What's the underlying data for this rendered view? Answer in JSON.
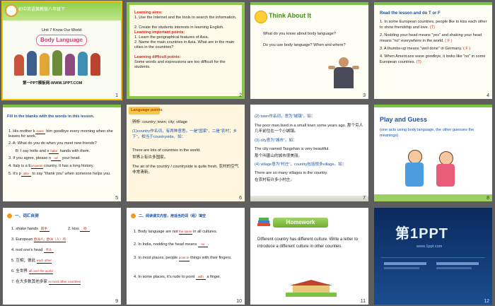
{
  "slides": [
    {
      "n": "1",
      "header": "初中英语冀教版八年级下",
      "unit": "Unit 7 Know Our World",
      "title": "Body Language",
      "footer": "第一PPT模板网-WWW.1PPT.COM"
    },
    {
      "n": "2",
      "l1": "Learning aims:",
      "l2": "1. Use the Internet and the tools to search the information.",
      "l3": "2. Create the students interests in learning English.",
      "l4": "Learning important points:",
      "l5": "1. Learn the geographical  features of Asia.",
      "l6": "2. Name the main countries in Asia. What are in the main cities in the countries?",
      "l7": "Learning difficult points:",
      "l8": "Some words and expressions are too difficult for the students."
    },
    {
      "n": "3",
      "title": "Think About It",
      "q1": "What do you know about body language?",
      "q2": "Do you use body language? When and where?"
    },
    {
      "n": "4",
      "title": "Read the lesson and do T or F",
      "s1": "1. In some European countries, people like to kiss each other to show friendship and love.",
      "a1": "(T)",
      "s2": "2. Nodding your head means  \"yes\" and shaking your head means \"no\" everywhere in the world.",
      "a2": "( F )",
      "s3": "3. A thumbs-up means \"well done\" in Germany.",
      "a3": "( F )",
      "s4": "4. When Americans wave goodbye, it looks like \"no\" in some European countries.",
      "a4": "(T)"
    },
    {
      "n": "5",
      "title": "Fill  in the blanks with the words in this lesson.",
      "i1a": "1.   His mother k",
      "i1f": "isses",
      "i1b": "him goodbye every morning when she leaves for work.",
      "i2": "2.   A: What do you do when you meet new friends?",
      "i2a": "B: I say hello and s",
      "i2f": "hake",
      "i2b": "hands with them.",
      "i3a": "3.   If you agree, please n",
      "i3f": "od",
      "i3b": "your head.",
      "i4a": "4.   Italy is a E",
      "i4f": "uropean",
      "i4b": "country. It has a long history.",
      "i5a": "5.   It's p",
      "i5f": "olite",
      "i5b": "to say \"thank you\" when someone helps you."
    },
    {
      "n": "6",
      "heading": "Language points",
      "key": "辨析: country; town; city; village",
      "p1": "(1)country作名词，有两种意思，一是“国家”，二是“农村；乡下”，相当于countryside。如：",
      "e1": "There are lots of countries in the world.",
      "c1": "世界上有许多国家。",
      "e2": "The air of the country / countryside is quite fresh. 农村的空气非常清新。"
    },
    {
      "n": "7",
      "p2": "(2) town作名词，意为“城镇”。如：",
      "e3": "The poor man lived in a small town some years ago. 那个穷人几年前住在一个小城镇。",
      "p3": "(3) city意为“城市”。如：",
      "e4": "The city named Tangshan is very beautiful.",
      "c4": "那个叫唐山的城市很美丽。",
      "p4": "(4) village意为“村庄”，country包括很多village。如：",
      "e5": "There are so many villages in the country.",
      "c5": "在农村有许多小村庄。"
    },
    {
      "n": "8",
      "title": "Play and Guess",
      "sub": "(one acts using body language, the other guesses the meanings)"
    },
    {
      "n": "9",
      "heading": "一、词汇自测",
      "v1": "1.  shake hands",
      "v1a": "握手",
      "v2": "2.  kiss",
      "v2a": "吻",
      "v3": "3.  European",
      "v3a": "欧洲人；欧洲（人）的",
      "v4": "4.  nod one's head",
      "v4a": "点头",
      "v5": "5.  互相；彼此",
      "v5a": "each other",
      "v6": "6.  全世界",
      "v6a": "all over the world",
      "v7": "7.  在大多数其他多家",
      "v7a": "in most other countries"
    },
    {
      "n": "10",
      "heading": "二、阅读课文内容，用适当的词（组）填空",
      "f1a": "1.  Body language are not",
      "f1f": "the same",
      "f1b": "in all cultures.",
      "f2a": "2.  In India, nodding the head means",
      "f2f": "no",
      "f2b": ".",
      "f3a": "3.  In most places, people",
      "f3f": "point to",
      "f3b": "things with their fingers.",
      "f4a": "4.  In some places, it's rude to point",
      "f4f": "with",
      "f4b": "a finger."
    },
    {
      "n": "11",
      "title": "Homework",
      "text": "Different  country has different culture.  Write a letter to introduce a different culture in other counties."
    },
    {
      "n": "12",
      "logo": "第1PPT",
      "url": "www.1ppt.com"
    }
  ]
}
